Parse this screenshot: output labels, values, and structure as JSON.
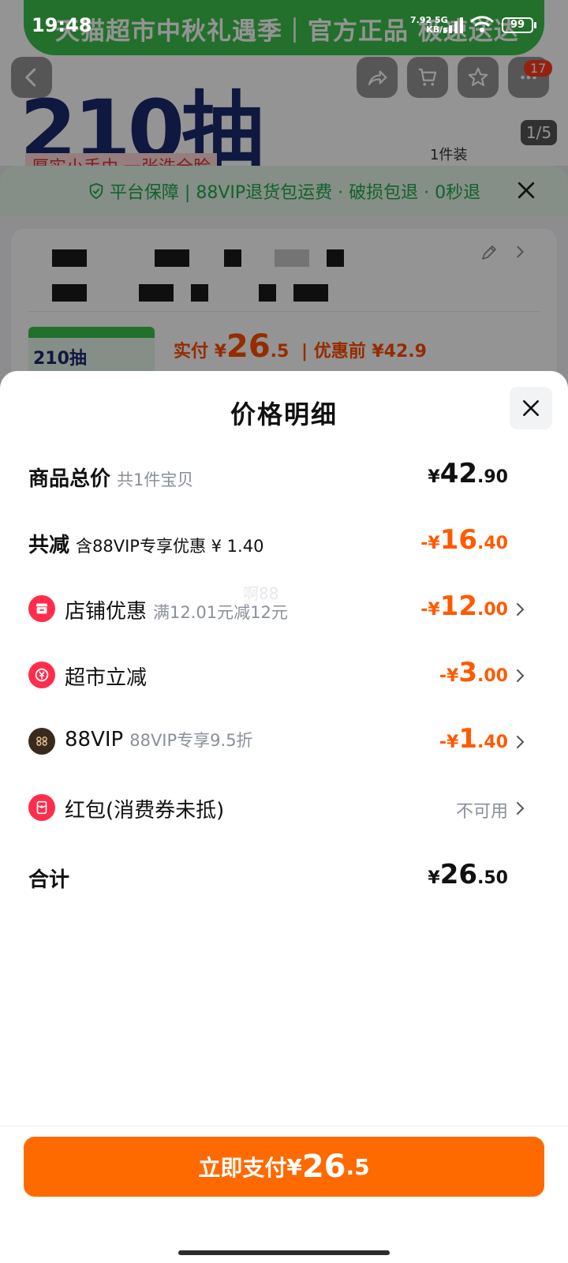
{
  "status_bar": {
    "time": "19:48",
    "net_speed": "7.92",
    "net_unit": "KB/s",
    "net_type": "5G",
    "battery": "99"
  },
  "background": {
    "banner_title": "天猫超市中秋礼遇季｜官方正品 极速送达",
    "big_text": "210抽",
    "subtitle": "厚实小手巾 一张洗全脸",
    "pack_label": "1件装",
    "image_pager": "1/5",
    "cart_badge": "17",
    "guarantee_text": "平台保障 | 88VIP退货包运费 · 破损包退 · 0秒退",
    "thumb_text": "210抽",
    "pay_label": "实付",
    "pay_currency": "¥",
    "pay_int": "26",
    "pay_dec": ".5",
    "orig_price": "| 优惠前 ¥42.9"
  },
  "sheet": {
    "title": "价格明细",
    "watermark": "啊88",
    "rows": [
      {
        "label": "商品总价",
        "sub": "共1件宝贝",
        "cur": "¥",
        "int": "42",
        "dec": ".90"
      },
      {
        "label": "共减",
        "sub": "含88VIP专享优惠 ¥ 1.40",
        "cur": "-¥",
        "int": "16",
        "dec": ".40"
      },
      {
        "label": "店铺优惠",
        "sub": "满12.01元减12元",
        "cur": "-¥",
        "int": "12",
        "dec": ".00",
        "icon": "shop-icon"
      },
      {
        "label": "超市立减",
        "sub": "",
        "cur": "-¥",
        "int": "3",
        "dec": ".00",
        "icon": "yuan-discount-icon"
      },
      {
        "label": "88VIP",
        "sub": "88VIP专享9.5折",
        "cur": "-¥",
        "int": "1",
        "dec": ".40",
        "icon": "vip88-icon"
      },
      {
        "label": "红包(消费券未抵)",
        "sub": "",
        "status": "不可用",
        "icon": "red-packet-icon"
      },
      {
        "label": "合计",
        "sub": "",
        "cur": "¥",
        "int": "26",
        "dec": ".50"
      }
    ]
  },
  "pay_button": {
    "label": "立即支付",
    "cur": "¥",
    "int": "26",
    "dec": ".5"
  },
  "colors": {
    "accent_orange": "#ff6a00",
    "discount_orange": "#ff5a00",
    "guarantee_green": "#1fa84a",
    "icon_red": "#ff2d4b"
  }
}
